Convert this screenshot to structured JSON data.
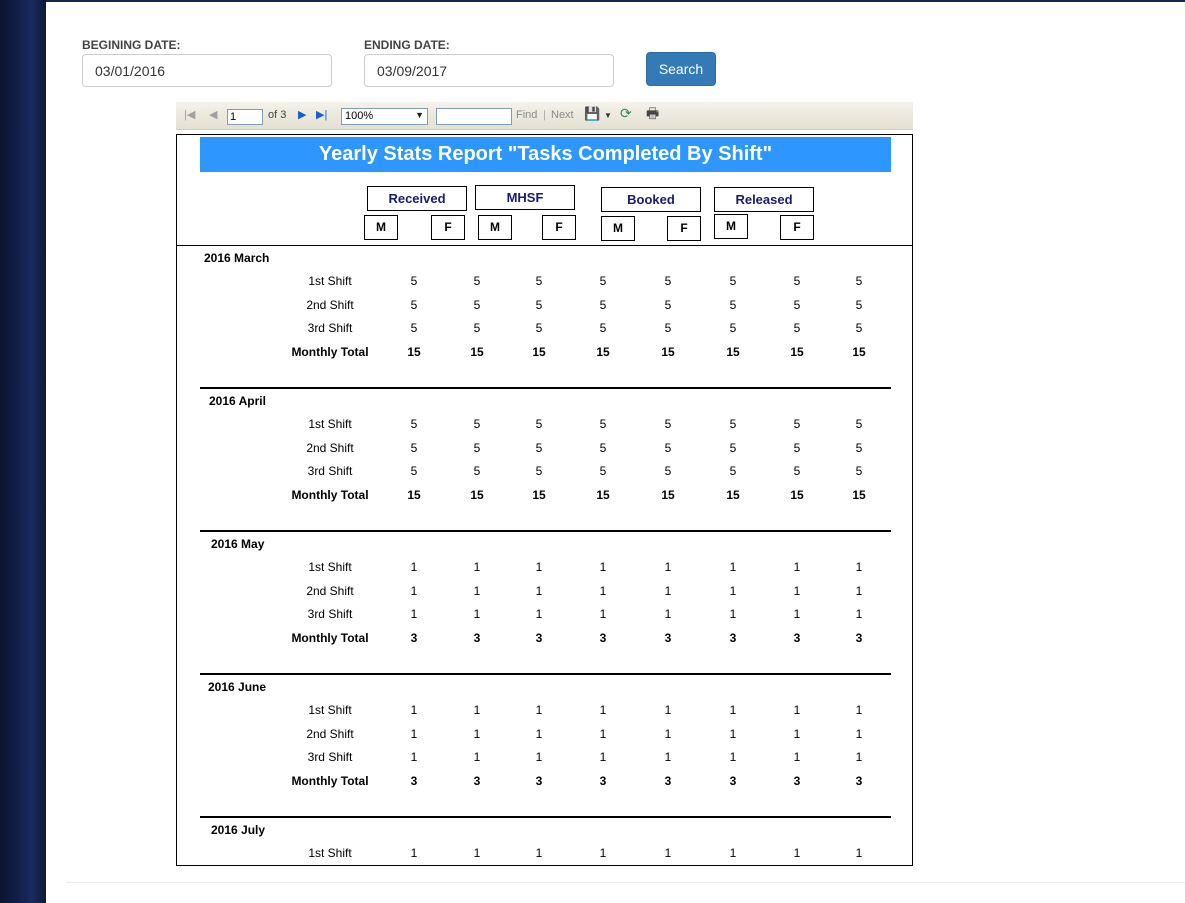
{
  "filters": {
    "begin_label": "BEGINING DATE:",
    "begin_value": "03/01/2016",
    "end_label": "ENDING DATE:",
    "end_value": "03/09/2017",
    "search_label": "Search"
  },
  "toolbar": {
    "page_current": "1",
    "page_of": "of 3",
    "zoom": "100%",
    "find_value": "",
    "find_label": "Find",
    "separator": "|",
    "next_label": "Next",
    "icons": [
      "first-page-icon",
      "prev-page-icon",
      "next-page-icon",
      "last-page-icon",
      "export-icon",
      "refresh-icon",
      "print-icon"
    ]
  },
  "report": {
    "title": "Yearly Stats Report \"Tasks Completed By Shift\"",
    "groups": [
      "Received",
      "MHSF",
      "Booked",
      "Released"
    ],
    "sub_cols": [
      "M",
      "F",
      "M",
      "F",
      "M",
      "F",
      "M",
      "F"
    ],
    "sections": [
      {
        "month": "2016 March",
        "rows": [
          {
            "label": "1st Shift",
            "values": [
              "5",
              "5",
              "5",
              "5",
              "5",
              "5",
              "5",
              "5"
            ]
          },
          {
            "label": "2nd Shift",
            "values": [
              "5",
              "5",
              "5",
              "5",
              "5",
              "5",
              "5",
              "5"
            ]
          },
          {
            "label": "3rd Shift",
            "values": [
              "5",
              "5",
              "5",
              "5",
              "5",
              "5",
              "5",
              "5"
            ]
          },
          {
            "label": "Monthly Total",
            "values": [
              "15",
              "15",
              "15",
              "15",
              "15",
              "15",
              "15",
              "15"
            ]
          }
        ]
      },
      {
        "month": "2016 April",
        "rows": [
          {
            "label": "1st Shift",
            "values": [
              "5",
              "5",
              "5",
              "5",
              "5",
              "5",
              "5",
              "5"
            ]
          },
          {
            "label": "2nd Shift",
            "values": [
              "5",
              "5",
              "5",
              "5",
              "5",
              "5",
              "5",
              "5"
            ]
          },
          {
            "label": "3rd Shift",
            "values": [
              "5",
              "5",
              "5",
              "5",
              "5",
              "5",
              "5",
              "5"
            ]
          },
          {
            "label": "Monthly Total",
            "values": [
              "15",
              "15",
              "15",
              "15",
              "15",
              "15",
              "15",
              "15"
            ]
          }
        ]
      },
      {
        "month": "2016 May",
        "rows": [
          {
            "label": "1st Shift",
            "values": [
              "1",
              "1",
              "1",
              "1",
              "1",
              "1",
              "1",
              "1"
            ]
          },
          {
            "label": "2nd Shift",
            "values": [
              "1",
              "1",
              "1",
              "1",
              "1",
              "1",
              "1",
              "1"
            ]
          },
          {
            "label": "3rd Shift",
            "values": [
              "1",
              "1",
              "1",
              "1",
              "1",
              "1",
              "1",
              "1"
            ]
          },
          {
            "label": "Monthly Total",
            "values": [
              "3",
              "3",
              "3",
              "3",
              "3",
              "3",
              "3",
              "3"
            ]
          }
        ]
      },
      {
        "month": "2016 June",
        "rows": [
          {
            "label": "1st Shift",
            "values": [
              "1",
              "1",
              "1",
              "1",
              "1",
              "1",
              "1",
              "1"
            ]
          },
          {
            "label": "2nd Shift",
            "values": [
              "1",
              "1",
              "1",
              "1",
              "1",
              "1",
              "1",
              "1"
            ]
          },
          {
            "label": "3rd Shift",
            "values": [
              "1",
              "1",
              "1",
              "1",
              "1",
              "1",
              "1",
              "1"
            ]
          },
          {
            "label": "Monthly Total",
            "values": [
              "3",
              "3",
              "3",
              "3",
              "3",
              "3",
              "3",
              "3"
            ]
          }
        ]
      },
      {
        "month": "2016 July",
        "rows": [
          {
            "label": "1st Shift",
            "values": [
              "1",
              "1",
              "1",
              "1",
              "1",
              "1",
              "1",
              "1"
            ]
          }
        ]
      }
    ]
  }
}
